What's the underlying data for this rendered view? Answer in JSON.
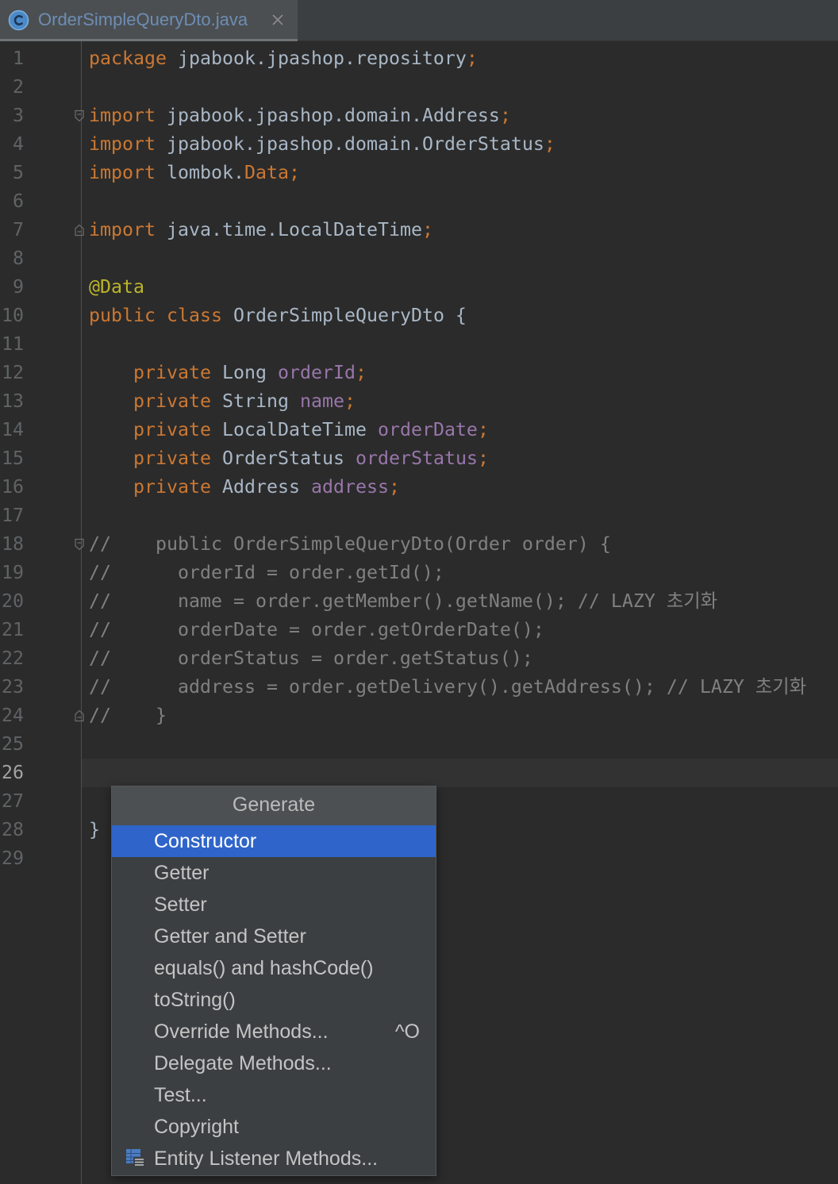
{
  "tab": {
    "title": "OrderSimpleQueryDto.java",
    "file_icon": "java-class-icon",
    "close_icon": "close-icon",
    "title_color": "#6e8db3"
  },
  "syntax_colors": {
    "keyword": "#cc7832",
    "identifier": "#a9b7c6",
    "field": "#9876aa",
    "annotation": "#bbb529",
    "comment": "#808080",
    "line_number": "#606366",
    "current_line_number": "#a4a3a3"
  },
  "editor": {
    "current_line": 26,
    "line_numbers": [
      "1",
      "2",
      "3",
      "4",
      "5",
      "6",
      "7",
      "8",
      "9",
      "10",
      "11",
      "12",
      "13",
      "14",
      "15",
      "16",
      "17",
      "18",
      "19",
      "20",
      "21",
      "22",
      "23",
      "24",
      "25",
      "26",
      "27",
      "28",
      "29"
    ],
    "lines": [
      [
        "package",
        " jpabook.jpashop.repository",
        ";"
      ],
      [],
      [
        "import",
        " jpabook.jpashop.domain.Address",
        ";"
      ],
      [
        "import",
        " jpabook.jpashop.domain.OrderStatus",
        ";"
      ],
      [
        "import",
        " lombok.",
        "Data;"
      ],
      [],
      [
        "import",
        " java.time.LocalDateTime",
        ";"
      ],
      [],
      [
        "@Data"
      ],
      [
        "public class",
        " OrderSimpleQueryDto {"
      ],
      [],
      [
        "    private",
        " Long ",
        "orderId",
        ";"
      ],
      [
        "    private",
        " String ",
        "name",
        ";"
      ],
      [
        "    private",
        " LocalDateTime ",
        "orderDate",
        ";"
      ],
      [
        "    private",
        " OrderStatus ",
        "orderStatus",
        ";"
      ],
      [
        "    private",
        " Address ",
        "address",
        ";"
      ],
      [],
      [
        "//    public OrderSimpleQueryDto(Order order) {"
      ],
      [
        "//      orderId = order.getId();"
      ],
      [
        "//      name = order.getMember().getName(); // LAZY 초기화"
      ],
      [
        "//      orderDate = order.getOrderDate();"
      ],
      [
        "//      orderStatus = order.getStatus();"
      ],
      [
        "//      address = order.getDelivery().getAddress(); // LAZY 초기화"
      ],
      [
        "//    }"
      ],
      [],
      [],
      [],
      [
        "}"
      ],
      []
    ],
    "fold_markers": [
      {
        "line": 3,
        "icon": "fold-collapse-icon"
      },
      {
        "line": 7,
        "icon": "fold-end-icon"
      },
      {
        "line": 18,
        "icon": "fold-collapse-icon"
      },
      {
        "line": 24,
        "icon": "fold-end-icon"
      }
    ]
  },
  "popup": {
    "title": "Generate",
    "selected_index": 0,
    "selection_color": "#2f65ca",
    "items": [
      {
        "label": "Constructor"
      },
      {
        "label": "Getter"
      },
      {
        "label": "Setter"
      },
      {
        "label": "Getter and Setter"
      },
      {
        "label": "equals() and hashCode()"
      },
      {
        "label": "toString()"
      },
      {
        "label": "Override Methods...",
        "shortcut": "^O"
      },
      {
        "label": "Delegate Methods..."
      },
      {
        "label": "Test..."
      },
      {
        "label": "Copyright"
      },
      {
        "label": "Entity Listener Methods...",
        "icon": "entity-listener-icon"
      }
    ]
  }
}
